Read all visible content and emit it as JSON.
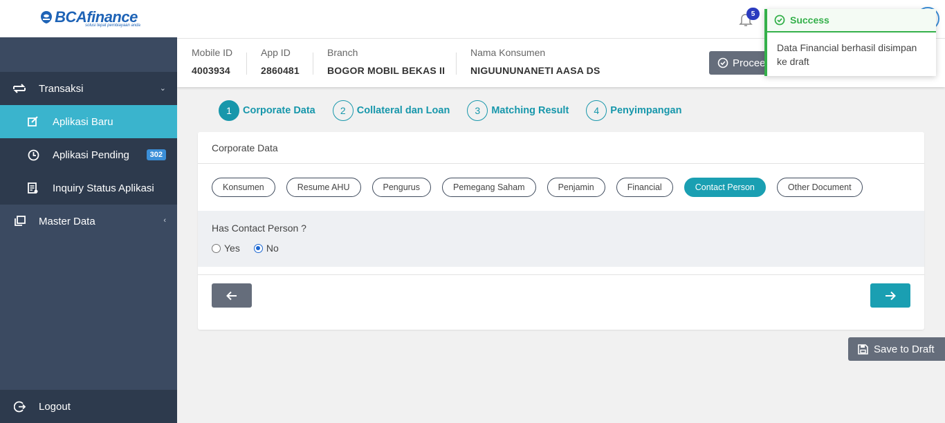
{
  "brand": {
    "logo_text": "BCAfinance",
    "tagline": "solusi tepat pembiayaan anda"
  },
  "sidebar": {
    "items": [
      {
        "label": "Transaksi",
        "icon": "transfer-icon",
        "chevron": "⌄"
      },
      {
        "label": "Aplikasi Baru",
        "icon": "edit-icon"
      },
      {
        "label": "Aplikasi Pending",
        "icon": "clock-icon",
        "badge": "302"
      },
      {
        "label": "Inquiry Status Aplikasi",
        "icon": "document-icon"
      },
      {
        "label": "Master Data",
        "icon": "copy-icon",
        "chevron": "‹"
      }
    ],
    "logout_label": "Logout"
  },
  "topbar": {
    "notification_count": "5"
  },
  "info": {
    "mobile_id_label": "Mobile ID",
    "mobile_id": "4003934",
    "app_id_label": "App ID",
    "app_id": "2860481",
    "branch_label": "Branch",
    "branch": "BOGOR MOBIL BEKAS II",
    "nama_label": "Nama Konsumen",
    "nama": "NIGUUNUNANETI AASA DS",
    "proceed_label": "Proceed"
  },
  "toast": {
    "title": "Success",
    "message": "Data Financial berhasil disimpan ke draft"
  },
  "stepper": {
    "steps": [
      {
        "num": "1",
        "label": "Corporate Data"
      },
      {
        "num": "2",
        "label": "Collateral dan Loan"
      },
      {
        "num": "3",
        "label": "Matching Result"
      },
      {
        "num": "4",
        "label": "Penyimpangan"
      }
    ]
  },
  "card": {
    "title": "Corporate Data",
    "tabs": [
      "Konsumen",
      "Resume AHU",
      "Pengurus",
      "Pemegang Saham",
      "Penjamin",
      "Financial",
      "Contact Person",
      "Other Document"
    ],
    "question": "Has Contact Person ?",
    "option_yes": "Yes",
    "option_no": "No",
    "selected": "No"
  },
  "actions": {
    "save_draft_label": "Save to Draft"
  },
  "colors": {
    "sidebar": "#3b4a61",
    "active": "#3ab4cd",
    "teal": "#1a9fb2",
    "success": "#34b04a"
  }
}
